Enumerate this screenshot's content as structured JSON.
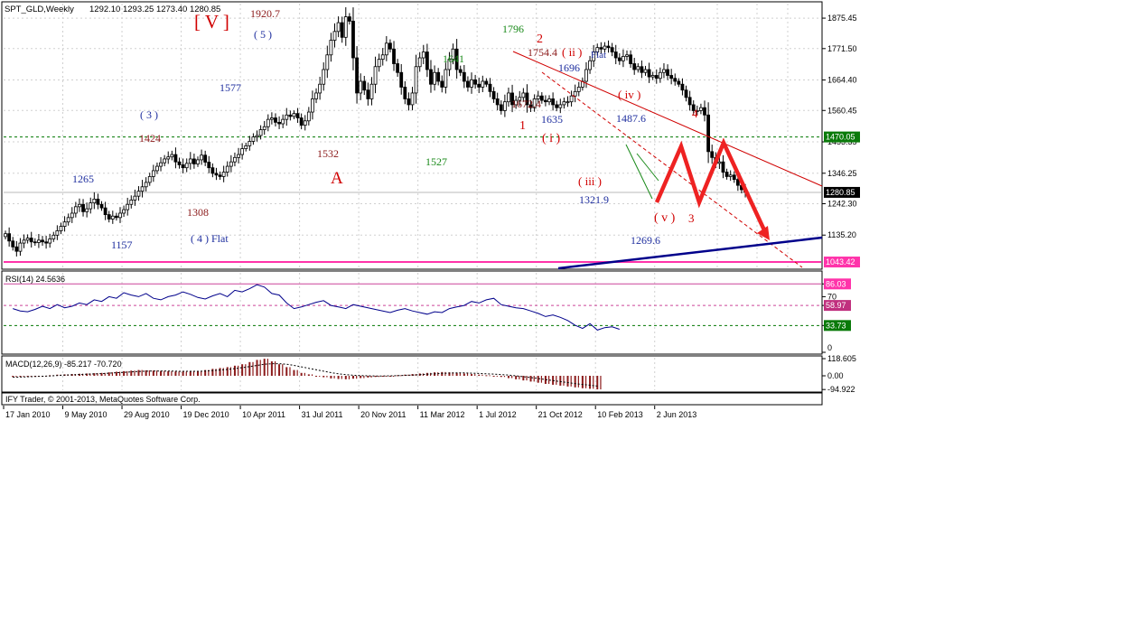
{
  "header": {
    "symbol": "SPT_GLD,Weekly",
    "ohlc": "1292.10 1293.25 1273.40 1280.85"
  },
  "copyright": "IFY Trader, © 2001-2013, MetaQuotes Software Corp.",
  "colors": {
    "bull": "#000000",
    "bear": "#000000",
    "wave_red": "#d00000",
    "wave_dark_red": "#8b1a1a",
    "wave_blue": "#1f2f9f",
    "wave_green": "#1a8a1a",
    "support_line": "#00008b",
    "magenta_line": "#ff33aa",
    "green_level": "#007700",
    "rsi_line": "#00008b",
    "macd_hist": "#8b1a1a"
  },
  "chart_data": [
    {
      "type": "candlestick",
      "name": "SPT_GLD,Weekly",
      "x_tick_labels": [
        "17 Jan 2010",
        "9 May 2010",
        "29 Aug 2010",
        "19 Dec 2010",
        "10 Apr 2011",
        "31 Jul 2011",
        "20 Nov 2011",
        "11 Mar 2012",
        "1 Jul 2012",
        "21 Oct 2012",
        "10 Feb 2013",
        "2 Jun 2013"
      ],
      "y_tick_labels": [
        "1875.45",
        "1771.50",
        "1664.40",
        "1560.45",
        "1453.35",
        "1346.25",
        "1242.30",
        "1135.20"
      ],
      "ylim": [
        1025,
        1925
      ],
      "weeks_to_right_edge": 221,
      "current_price_label": "1280.85",
      "level_labels": [
        {
          "value": 1470.05,
          "label": "1470.05",
          "style": "dashed-green"
        },
        {
          "value": 1043.42,
          "label": "1043.42",
          "style": "solid-magenta"
        }
      ],
      "closes": [
        1140,
        1115,
        1095,
        1080,
        1108,
        1118,
        1125,
        1112,
        1110,
        1118,
        1112,
        1108,
        1122,
        1135,
        1150,
        1165,
        1180,
        1195,
        1210,
        1232,
        1240,
        1215,
        1225,
        1245,
        1258,
        1240,
        1228,
        1205,
        1190,
        1200,
        1195,
        1210,
        1222,
        1240,
        1255,
        1268,
        1285,
        1300,
        1315,
        1335,
        1355,
        1370,
        1382,
        1395,
        1402,
        1410,
        1385,
        1375,
        1365,
        1380,
        1395,
        1378,
        1392,
        1408,
        1384,
        1365,
        1346,
        1340,
        1335,
        1350,
        1370,
        1385,
        1400,
        1410,
        1430,
        1440,
        1455,
        1470,
        1475,
        1495,
        1505,
        1530,
        1535,
        1520,
        1515,
        1530,
        1545,
        1540,
        1550,
        1535,
        1510,
        1525,
        1555,
        1600,
        1620,
        1650,
        1700,
        1750,
        1800,
        1830,
        1860,
        1810,
        1880,
        1865,
        1740,
        1620,
        1660,
        1630,
        1600,
        1650,
        1710,
        1735,
        1750,
        1790,
        1770,
        1720,
        1690,
        1640,
        1600,
        1580,
        1620,
        1710,
        1740,
        1760,
        1700,
        1650,
        1690,
        1660,
        1640,
        1700,
        1735,
        1770,
        1700,
        1690,
        1660,
        1640,
        1665,
        1650,
        1640,
        1660,
        1650,
        1625,
        1600,
        1580,
        1560,
        1590,
        1620,
        1580,
        1595,
        1605,
        1620,
        1580,
        1570,
        1600,
        1610,
        1595,
        1590,
        1600,
        1580,
        1570,
        1580,
        1590,
        1590,
        1610,
        1625,
        1640,
        1660,
        1700,
        1730,
        1760,
        1775,
        1770,
        1780,
        1775,
        1760,
        1740,
        1730,
        1745,
        1750,
        1720,
        1700,
        1710,
        1690,
        1700,
        1675,
        1680,
        1670,
        1690,
        1700,
        1680,
        1670,
        1660,
        1650,
        1630,
        1605,
        1580,
        1560,
        1560,
        1570,
        1545,
        1420,
        1400,
        1380,
        1385,
        1350,
        1335,
        1340,
        1325,
        1305,
        1290,
        1281
      ],
      "annotations": [
        {
          "text": "[ V ]",
          "color": "wave_red",
          "big": true
        },
        {
          "text": "1920.7",
          "color": "wave_dark_red"
        },
        {
          "text": "( 5 )",
          "color": "wave_blue"
        },
        {
          "text": "1577",
          "color": "wave_blue"
        },
        {
          "text": "( 3 )",
          "color": "wave_blue"
        },
        {
          "text": "1424",
          "color": "wave_dark_red"
        },
        {
          "text": "1265",
          "color": "wave_blue"
        },
        {
          "text": "1308",
          "color": "wave_dark_red"
        },
        {
          "text": "( 4 )  Flat",
          "color": "wave_blue"
        },
        {
          "text": "1157",
          "color": "wave_blue"
        },
        {
          "text": "1532",
          "color": "wave_dark_red"
        },
        {
          "text": "A",
          "color": "wave_red",
          "big": true
        },
        {
          "text": "1641",
          "color": "wave_green"
        },
        {
          "text": "1527",
          "color": "wave_green"
        },
        {
          "text": "1796",
          "color": "wave_green"
        },
        {
          "text": "2",
          "color": "wave_red"
        },
        {
          "text": "1754.4",
          "color": "wave_dark_red"
        },
        {
          "text": "( ii )",
          "color": "wave_red"
        },
        {
          "text": "Flat",
          "color": "wave_blue"
        },
        {
          "text": "1696",
          "color": "wave_blue"
        },
        {
          "text": "1672.4",
          "color": "wave_dark_red"
        },
        {
          "text": "1635",
          "color": "wave_blue"
        },
        {
          "text": "1",
          "color": "wave_red"
        },
        {
          "text": "( i )",
          "color": "wave_red"
        },
        {
          "text": "( iv )",
          "color": "wave_red"
        },
        {
          "text": "1487.6",
          "color": "wave_blue"
        },
        {
          "text": "4",
          "color": "wave_red"
        },
        {
          "text": "( iii )",
          "color": "wave_red"
        },
        {
          "text": "1321.9",
          "color": "wave_blue"
        },
        {
          "text": "( v )",
          "color": "wave_red"
        },
        {
          "text": "3",
          "color": "wave_red"
        },
        {
          "text": "1269.6",
          "color": "wave_blue"
        }
      ]
    },
    {
      "type": "line",
      "name": "RSI(14) 24.5636",
      "ylim": [
        0,
        100
      ],
      "y_tick_labels": [
        "86.03",
        "70",
        "58.97",
        "33.73",
        "0"
      ],
      "levels": [
        {
          "value": 86.03,
          "label": "86.03",
          "style": "pink"
        },
        {
          "value": 58.97,
          "label": "58.97",
          "style": "dashed-pink"
        },
        {
          "value": 33.73,
          "label": "33.73",
          "style": "dashed-green"
        }
      ],
      "values_sampled_every_2_weeks": [
        55,
        52,
        51,
        54,
        58,
        55,
        60,
        56,
        58,
        62,
        60,
        66,
        64,
        70,
        68,
        75,
        72,
        70,
        74,
        68,
        66,
        70,
        72,
        76,
        73,
        69,
        67,
        71,
        74,
        70,
        78,
        76,
        80,
        85,
        82,
        74,
        72,
        62,
        55,
        57,
        60,
        63,
        65,
        59,
        57,
        55,
        60,
        58,
        56,
        54,
        52,
        50,
        53,
        55,
        52,
        50,
        48,
        51,
        50,
        55,
        57,
        59,
        64,
        62,
        66,
        68,
        60,
        58,
        56,
        55,
        52,
        49,
        45,
        47,
        44,
        40,
        34,
        30,
        36,
        28,
        31,
        32,
        29
      ]
    },
    {
      "type": "bar",
      "name": "MACD(12,26,9) -85.217 -70.720",
      "y_tick_labels": [
        "118.605",
        "0.00",
        "-94.922"
      ],
      "ylim": [
        -100,
        125
      ],
      "histogram_sampled_every_2_weeks": [
        -8,
        -6,
        -4,
        -2,
        0,
        4,
        8,
        10,
        12,
        14,
        16,
        18,
        20,
        24,
        28,
        32,
        36,
        40,
        38,
        36,
        34,
        32,
        30,
        28,
        30,
        34,
        40,
        48,
        54,
        60,
        70,
        80,
        95,
        110,
        118,
        100,
        80,
        60,
        40,
        20,
        10,
        0,
        -10,
        -18,
        -22,
        -24,
        -20,
        -16,
        -12,
        -8,
        -4,
        0,
        4,
        8,
        12,
        16,
        20,
        24,
        26,
        24,
        20,
        16,
        12,
        8,
        4,
        0,
        -8,
        -16,
        -24,
        -32,
        -40,
        -48,
        -56,
        -62,
        -68,
        -74,
        -80,
        -86,
        -90,
        -94
      ],
      "signal_sampled_every_2_weeks": [
        -10,
        -9,
        -7,
        -5,
        -3,
        -1,
        2,
        5,
        7,
        9,
        11,
        13,
        15,
        18,
        21,
        24,
        27,
        30,
        32,
        33,
        33,
        33,
        32,
        31,
        31,
        31,
        33,
        36,
        40,
        44,
        50,
        56,
        64,
        72,
        80,
        84,
        84,
        80,
        72,
        62,
        52,
        42,
        32,
        22,
        14,
        8,
        4,
        2,
        0,
        -1,
        -1,
        0,
        1,
        3,
        5,
        8,
        11,
        14,
        17,
        19,
        20,
        20,
        18,
        16,
        14,
        12,
        9,
        5,
        0,
        -6,
        -12,
        -19,
        -26,
        -33,
        -40,
        -47,
        -54,
        -60,
        -65,
        -71
      ]
    }
  ]
}
